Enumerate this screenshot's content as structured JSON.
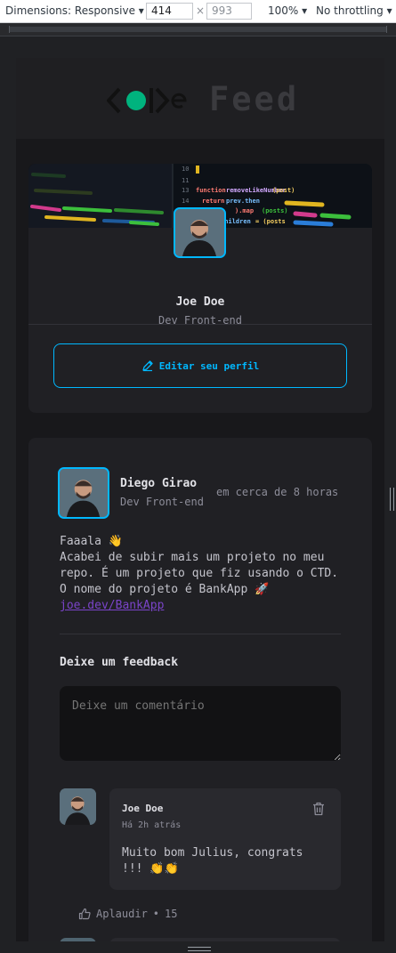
{
  "devtools": {
    "dimensions_label": "Dimensions: Responsive",
    "width_value": "414",
    "times": "×",
    "height_placeholder": "993",
    "zoom": "100%",
    "throttling": "No throttling"
  },
  "header": {
    "logo_alt": "code",
    "title": "Feed"
  },
  "profile": {
    "name": "Joe Doe",
    "role": "Dev Front-end",
    "edit_button": "Editar seu perfil"
  },
  "post": {
    "author_name": "Diego Girao",
    "author_role": "Dev Front-end",
    "time": "em cerca de 8 horas",
    "line1": "Faaala 👋",
    "line2": "Acabei de subir mais um projeto no meu repo. É um projeto que fiz usando o CTD. O nome do projeto é BankApp 🚀",
    "link": "joe.dev/BankApp",
    "feedback_title": "Deixe um feedback",
    "comment_placeholder": "Deixe um comentário"
  },
  "comment": {
    "author": "Joe Doe",
    "time": "Há 2h atrás",
    "text": "Muito bom Julius, congrats !!! 👏👏",
    "applaud_label": "Aplaudir",
    "applaud_separator": "•",
    "applaud_count": "15"
  },
  "colors": {
    "accent": "#00b8ff",
    "link": "#7a44c9",
    "logo_dot": "#00b37e"
  }
}
